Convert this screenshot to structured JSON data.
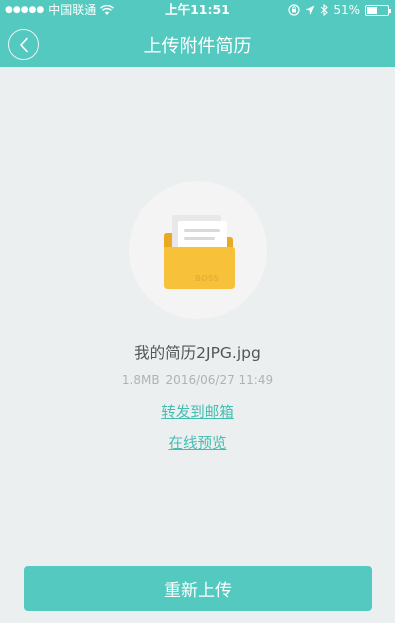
{
  "status_bar": {
    "carrier": "中国联通",
    "time": "上午11:51",
    "battery_percent": "51%",
    "battery_level": 0.51,
    "icons": [
      "signal-dots-icon",
      "wifi-icon",
      "lock-rotation-icon",
      "location-arrow-icon",
      "bluetooth-icon",
      "battery-icon"
    ]
  },
  "nav": {
    "title": "上传附件简历",
    "back_icon": "chevron-left-icon"
  },
  "file": {
    "name": "我的简历2JPG.jpg",
    "size": "1.8MB",
    "date": "2016/06/27 11:49",
    "icon": "folder-document-icon"
  },
  "actions": {
    "forward_email": "转发到邮箱",
    "preview_online": "在线预览",
    "reupload": "重新上传"
  },
  "colors": {
    "brand": "#54c9bf",
    "link": "#44bdb1",
    "background": "#ebeff0",
    "folder": "#f7c23a"
  }
}
